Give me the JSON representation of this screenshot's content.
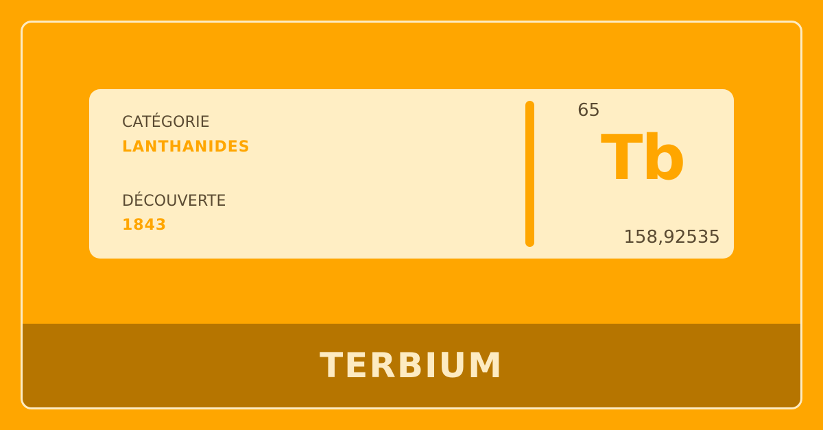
{
  "element": {
    "category_label": "CATÉGORIE",
    "category": "LANTHANIDES",
    "discovery_label": "DÉCOUVERTE",
    "discovery_year": "1843",
    "atomic_number": "65",
    "symbol": "Tb",
    "atomic_mass": "158,92535",
    "name": "TERBIUM"
  },
  "colors": {
    "background": "#ffa600",
    "card": "#ffeec4",
    "accent": "#ffa600",
    "footer": "#b67500",
    "text": "#5a4a32",
    "name_text": "#fdebc2"
  }
}
